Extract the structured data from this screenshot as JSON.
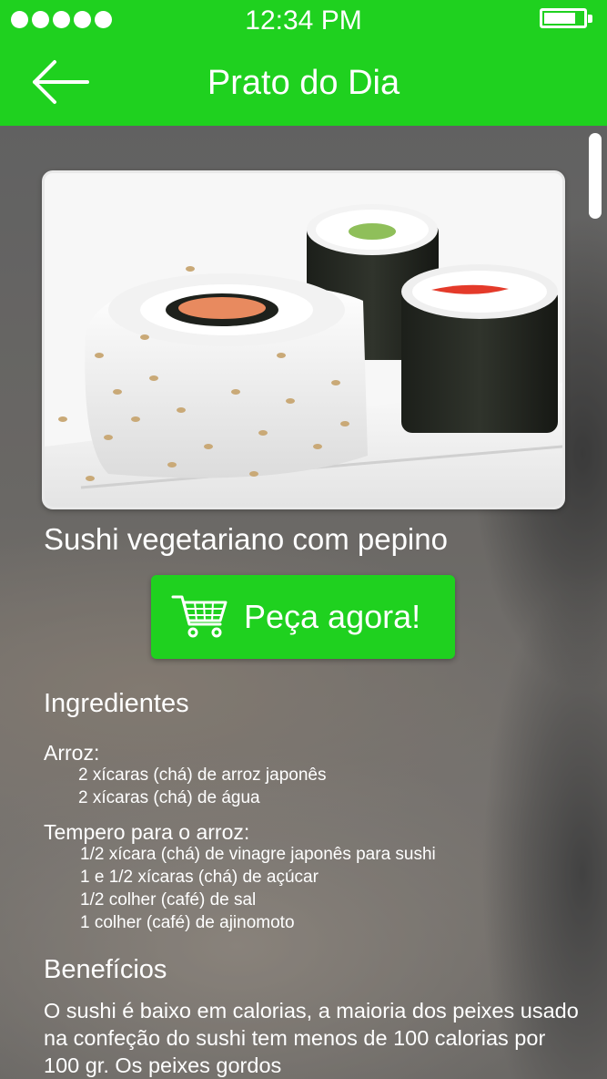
{
  "status_bar": {
    "time": "12:34 PM"
  },
  "header": {
    "title": "Prato do Dia"
  },
  "dish": {
    "name": "Sushi vegetariano com pepino",
    "order_label": "Peça agora!"
  },
  "ingredients": {
    "title": "Ingredientes",
    "groups": [
      {
        "title": "Arroz:",
        "items": [
          "2 xícaras (chá) de arroz japonês",
          "2 xícaras (chá) de água"
        ]
      },
      {
        "title": "Tempero para o arroz:",
        "items": [
          "1/2 xícara (chá) de vinagre japonês para sushi",
          "1 e 1/2 xícaras (chá) de açúcar",
          "1/2 colher (café) de sal",
          "1 colher (café) de ajinomoto"
        ]
      }
    ]
  },
  "benefits": {
    "title": "Benefícios",
    "text": "O sushi é baixo em calorias, a maioria dos peixes usado na confeção do sushi tem menos de 100 calorias por 100 gr. Os peixes gordos"
  },
  "icons": {
    "back": "arrow-left-icon",
    "cart": "shopping-cart-icon",
    "signal": "signal-dots-icon",
    "battery": "battery-icon"
  },
  "colors": {
    "accent": "#1fd11f",
    "text": "#ffffff"
  },
  "battery_level": 0.85
}
